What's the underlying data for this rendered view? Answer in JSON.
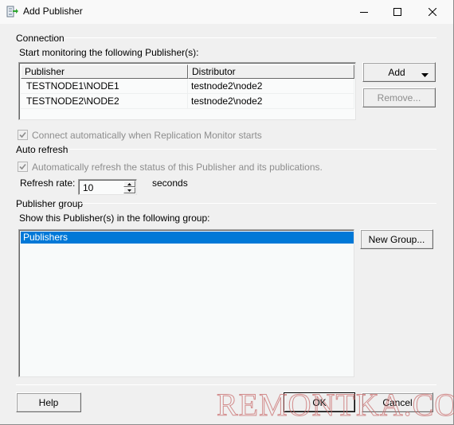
{
  "window": {
    "title": "Add Publisher",
    "icon": "add-publisher-icon",
    "controls": {
      "minimize": "minimize-icon",
      "maximize": "maximize-icon",
      "close": "close-icon"
    }
  },
  "connection": {
    "group_label": "Connection",
    "instructions": "Start monitoring the following Publisher(s):",
    "columns": [
      "Publisher",
      "Distributor"
    ],
    "rows": [
      {
        "publisher": "TESTNODE1\\NODE1",
        "distributor": "testnode2\\node2"
      },
      {
        "publisher": "TESTNODE2\\NODE2",
        "distributor": "testnode2\\node2"
      }
    ],
    "add_label": "Add",
    "remove_label": "Remove...",
    "auto_connect_label": "Connect automatically when Replication Monitor starts",
    "auto_connect_checked": true,
    "auto_connect_enabled": false
  },
  "auto_refresh": {
    "group_label": "Auto refresh",
    "auto_refresh_label": "Automatically refresh the status of this Publisher and its publications.",
    "auto_refresh_checked": true,
    "auto_refresh_enabled": false,
    "refresh_rate_label": "Refresh rate:",
    "refresh_rate_value": "10",
    "seconds_label": "seconds"
  },
  "publisher_group": {
    "group_label": "Publisher group",
    "instructions": "Show this Publisher(s) in the following group:",
    "groups": [
      "Publishers"
    ],
    "selected": "Publishers",
    "new_group_label": "New Group..."
  },
  "footer": {
    "help_label": "Help",
    "ok_label": "OK",
    "cancel_label": "Cancel"
  },
  "watermark": "REMONTKA.COM"
}
